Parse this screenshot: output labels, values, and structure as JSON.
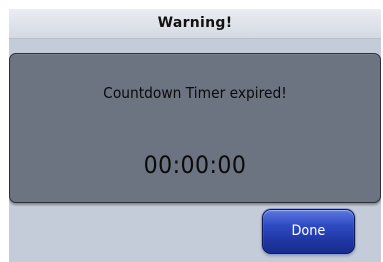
{
  "dialog": {
    "title": "Warning!",
    "message": "Countdown Timer expired!",
    "timer": "00:00:00",
    "done_label": "Done"
  },
  "colors": {
    "dialog_background": "#c5ccd9",
    "panel_background": "#6c7381",
    "button_blue": "#2f4bc3"
  }
}
